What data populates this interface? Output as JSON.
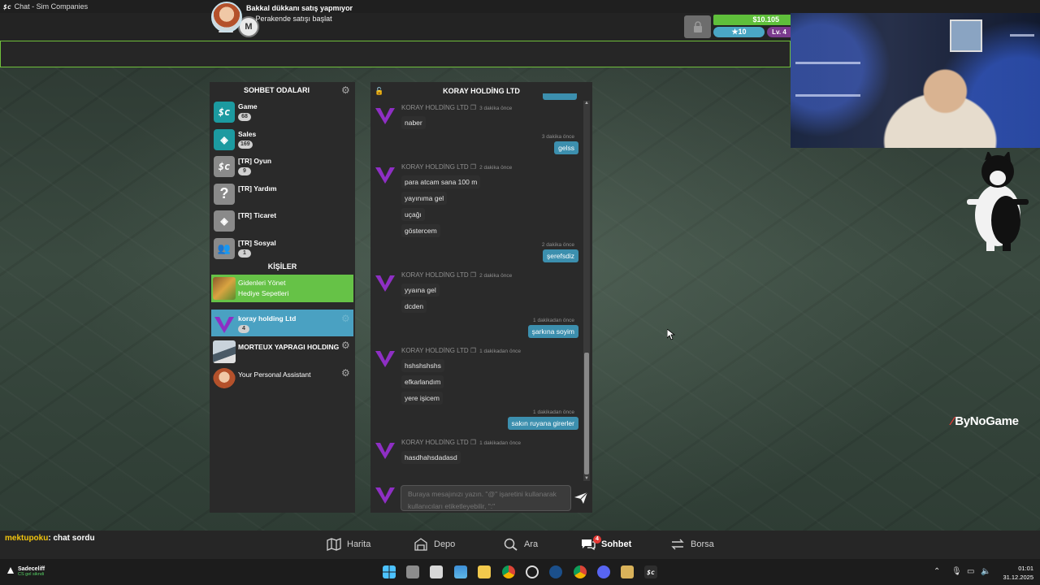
{
  "window": {
    "title": "Chat - Sim Companies",
    "logo": "$c"
  },
  "header": {
    "menu_icon": "hamburger-icon",
    "seal_label": "M",
    "money": "$10.105",
    "rating": "10",
    "level": "Lv. 4"
  },
  "notice": {
    "title": "Bakkal dükkanı satış yapmıyor",
    "action": "Perakende satışı başlat"
  },
  "rooms": {
    "title": "SOHBET ODALARI",
    "items": [
      {
        "name": "Game",
        "count": "68",
        "icon": "sc-logo-icon",
        "color": "#1c9aa0"
      },
      {
        "name": "Sales",
        "count": "169",
        "icon": "sale-tag-icon",
        "color": "#1c9aa0"
      },
      {
        "name": "[TR] Oyun",
        "count": "9",
        "icon": "sc-logo-icon",
        "color": "#8a8a8a"
      },
      {
        "name": "[TR] Yardım",
        "count": "",
        "icon": "question-icon",
        "color": "#8a8a8a"
      },
      {
        "name": "[TR] Ticaret",
        "count": "",
        "icon": "sale-tag-icon",
        "color": "#8a8a8a"
      },
      {
        "name": "[TR] Sosyal",
        "count": "1",
        "icon": "people-icon",
        "color": "#8a8a8a"
      }
    ]
  },
  "contacts": {
    "title": "KİŞİLER",
    "gifts": {
      "line1": "Gidenleri Yönet",
      "line2": "Hediye Sepetleri"
    },
    "items": [
      {
        "name": "koray holding Ltd",
        "count": "4"
      },
      {
        "name": "MORTEUX YAPRAGI HOLDING",
        "count": ""
      },
      {
        "name": "Your Personal Assistant",
        "count": ""
      }
    ]
  },
  "chat": {
    "title": "KORAY HOLDİNG LTD",
    "sender": "KORAY HOLDİNG LTD",
    "messages": [
      {
        "dir": "in",
        "time": "3 dakika önce",
        "lines": [
          "naber"
        ]
      },
      {
        "dir": "out",
        "time": "3 dakika önce",
        "lines": [
          "gelss"
        ]
      },
      {
        "dir": "in",
        "time": "2 dakika önce",
        "lines": [
          "para atcam sana 100 m",
          "yayınıma gel",
          "uçağı",
          "göstercem"
        ]
      },
      {
        "dir": "out",
        "time": "2 dakika önce",
        "lines": [
          "şerefsdiz"
        ]
      },
      {
        "dir": "in",
        "time": "2 dakika önce",
        "lines": [
          "yyaına gel",
          "dcden"
        ]
      },
      {
        "dir": "out",
        "time": "1 dakikadan önce",
        "lines": [
          "şarkına soyim"
        ]
      },
      {
        "dir": "in",
        "time": "1 dakikadan önce",
        "lines": [
          "hshshshshs",
          "efkarlandım",
          "yere işicem"
        ]
      },
      {
        "dir": "out",
        "time": "1 dakikadan önce",
        "lines": [
          "sakın ruyana girerler"
        ]
      },
      {
        "dir": "in",
        "time": "1 dakikadan önce",
        "lines": [
          "hasdhahsdadasd"
        ]
      }
    ],
    "input_placeholder": "Buraya mesajınızı yazın. \"@\" işaretini kullanarak kullanıcıları etiketleyebilir, \":\""
  },
  "nav": {
    "items": [
      {
        "label": "Harita",
        "icon": "map-icon"
      },
      {
        "label": "Depo",
        "icon": "warehouse-icon"
      },
      {
        "label": "Ara",
        "icon": "search-icon"
      },
      {
        "label": "Sohbet",
        "icon": "chat-icon",
        "badge": "4"
      },
      {
        "label": "Borsa",
        "icon": "exchange-icon"
      }
    ]
  },
  "stream_chat": {
    "user": "mektupoku",
    "text": ": chat sordu"
  },
  "watermark": "ByNoGame",
  "taskbar": {
    "user_name": "Sadeceliff",
    "user_status": "CS gel sikndi",
    "time": "01:01",
    "date": "31.12.2025"
  },
  "colors": {
    "accent_green": "#66c247",
    "accent_blue": "#4aa1c2",
    "bubble_out": "#3c8fae"
  }
}
